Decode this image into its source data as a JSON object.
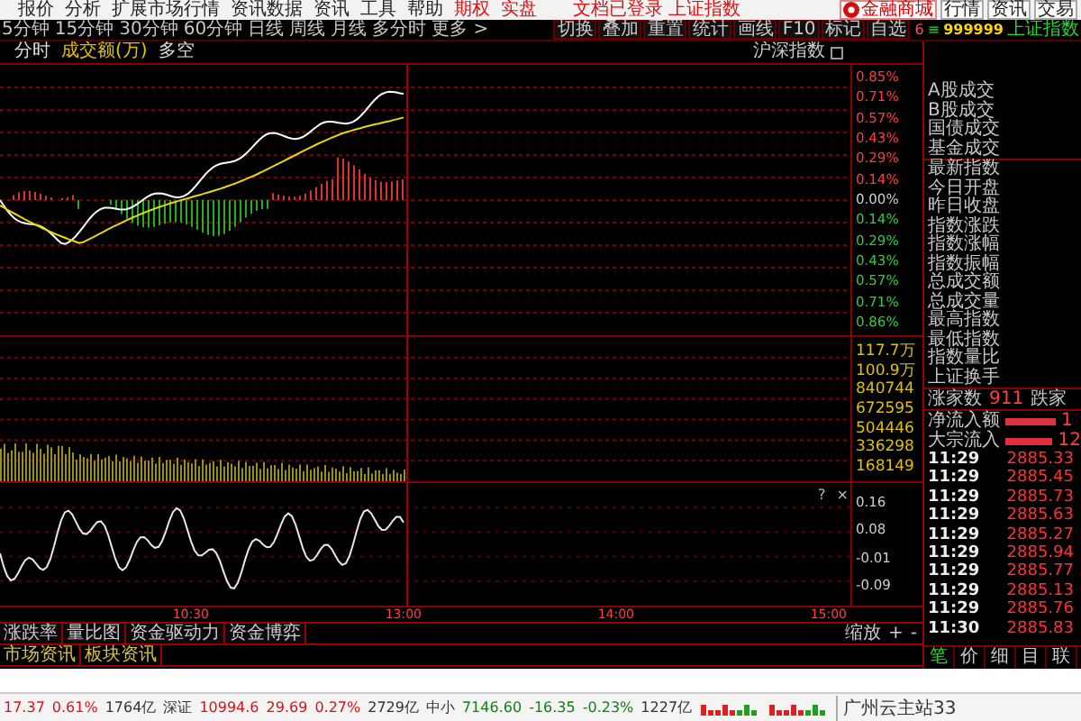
{
  "menu": [
    {
      "label": "报价",
      "kind": "normal"
    },
    {
      "label": "分析",
      "kind": "normal"
    },
    {
      "label": "扩展市场行情",
      "kind": "normal"
    },
    {
      "label": "资讯数据",
      "kind": "normal"
    },
    {
      "label": "资讯",
      "kind": "normal"
    },
    {
      "label": "工具",
      "kind": "normal"
    },
    {
      "label": "帮助",
      "kind": "normal"
    },
    {
      "label": "期权",
      "kind": "highlight"
    },
    {
      "label": "实盘",
      "kind": "highlight"
    }
  ],
  "login_notice": "文档已登录 上证指数",
  "top_buttons": [
    {
      "label": "金融商城",
      "kind": "mall"
    },
    {
      "label": "行情",
      "kind": "plain"
    },
    {
      "label": "资讯",
      "kind": "plain"
    },
    {
      "label": "交易",
      "kind": "plain"
    }
  ],
  "periods": [
    "5分钟",
    "15分钟",
    "30分钟",
    "60分钟",
    "日线",
    "周线",
    "月线",
    "多分时",
    "更多 >"
  ],
  "tools": [
    "切换",
    "叠加",
    "重置",
    "统计",
    "画线",
    "F10",
    "标记",
    "自选"
  ],
  "security": {
    "market": "6",
    "menu": "≡",
    "code": "999999",
    "name": "上证指数"
  },
  "chart_header": {
    "items": [
      {
        "label": "分时",
        "kind": "plain"
      },
      {
        "label": "成交额(万)",
        "kind": "volume"
      },
      {
        "label": "多空",
        "kind": "plain"
      }
    ],
    "index_toggle": {
      "label": "沪深指数",
      "checked": false
    }
  },
  "price_axis": [
    {
      "label": "0.85%",
      "color": "#ff3b3b"
    },
    {
      "label": "0.71%",
      "color": "#ff3b3b"
    },
    {
      "label": "0.57%",
      "color": "#ff3b3b"
    },
    {
      "label": "0.43%",
      "color": "#ff3b3b"
    },
    {
      "label": "0.29%",
      "color": "#ff3b3b"
    },
    {
      "label": "0.14%",
      "color": "#ff3b3b"
    },
    {
      "label": "0.00%",
      "color": "#d0d0d0"
    },
    {
      "label": "0.14%",
      "color": "#2ecc40"
    },
    {
      "label": "0.29%",
      "color": "#2ecc40"
    },
    {
      "label": "0.43%",
      "color": "#2ecc40"
    },
    {
      "label": "0.57%",
      "color": "#2ecc40"
    },
    {
      "label": "0.71%",
      "color": "#2ecc40"
    },
    {
      "label": "0.86%",
      "color": "#2ecc40"
    }
  ],
  "volume_axis": [
    "117.7万",
    "100.9万",
    "840744",
    "672595",
    "504446",
    "336298",
    "168149"
  ],
  "indicator_controls": [
    "?",
    "×"
  ],
  "indicator_axis": [
    "0.16",
    "0.08",
    "-0.01",
    "-0.09"
  ],
  "time_axis": [
    "10:30",
    "13:00",
    "14:00",
    "15:00"
  ],
  "zoom_controls": {
    "label": "缩放",
    "buttons": [
      "+",
      "-"
    ]
  },
  "indicator_tabs": [
    "涨跌率",
    "量比图",
    "资金驱动力",
    "资金博弈"
  ],
  "news_tabs": [
    "市场资讯",
    "板块资讯"
  ],
  "quote_fields": [
    "A股成交",
    "B股成交",
    "国债成交",
    "基金成交",
    "最新指数",
    "今日开盘",
    "昨日收盘",
    "指数涨跌",
    "指数涨幅",
    "指数振幅",
    "总成交额",
    "总成交量",
    "最高指数",
    "最低指数",
    "指数量比",
    "上证换手"
  ],
  "breadth": {
    "up_label": "涨家数",
    "up_count": "911",
    "down_label": "跌家"
  },
  "flows": [
    {
      "label": "净流入额",
      "value": "1"
    },
    {
      "label": "大宗流入",
      "value": "12"
    }
  ],
  "ticks": [
    {
      "time": "11:29",
      "price": "2885.33"
    },
    {
      "time": "11:29",
      "price": "2885.45"
    },
    {
      "time": "11:29",
      "price": "2885.73"
    },
    {
      "time": "11:29",
      "price": "2885.63"
    },
    {
      "time": "11:29",
      "price": "2885.27"
    },
    {
      "time": "11:29",
      "price": "2885.94"
    },
    {
      "time": "11:29",
      "price": "2885.77"
    },
    {
      "time": "11:29",
      "price": "2885.13"
    },
    {
      "time": "11:29",
      "price": "2885.76"
    },
    {
      "time": "11:30",
      "price": "2885.83"
    }
  ],
  "detail_tabs": [
    {
      "label": "笔",
      "selected": true
    },
    {
      "label": "价",
      "selected": false
    },
    {
      "label": "细",
      "selected": false
    },
    {
      "label": "目",
      "selected": false
    },
    {
      "label": "联",
      "selected": false
    }
  ],
  "status_items": [
    {
      "text": "17.37",
      "color": "#e01010"
    },
    {
      "text": "0.61%",
      "color": "#e01010"
    },
    {
      "text": "1764亿",
      "color": "#333333"
    },
    {
      "text": "深证",
      "color": "#333333"
    },
    {
      "text": "10994.6",
      "color": "#e01010"
    },
    {
      "text": "29.69",
      "color": "#e01010"
    },
    {
      "text": "0.27%",
      "color": "#e01010"
    },
    {
      "text": "2729亿",
      "color": "#333333"
    },
    {
      "text": "中小",
      "color": "#333333"
    },
    {
      "text": "7146.60",
      "color": "#108010"
    },
    {
      "text": "-16.35",
      "color": "#108010"
    },
    {
      "text": "-0.23%",
      "color": "#108010"
    },
    {
      "text": "1227亿",
      "color": "#333333"
    }
  ],
  "server": "广州云主站33"
}
